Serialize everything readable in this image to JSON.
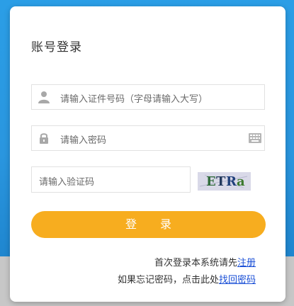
{
  "login": {
    "title": "账号登录",
    "id_placeholder": "请输入证件号码（字母请输入大写）",
    "password_placeholder": "请输入密码",
    "captcha_placeholder": "请输入验证码",
    "captcha_text": [
      "E",
      "T",
      "R",
      "a"
    ],
    "login_button": "登 录",
    "first_login_text": "首次登录本系统请先",
    "register_link": "注册",
    "forgot_text": "如果忘记密码，点击此处",
    "recover_link": "找回密码"
  },
  "colors": {
    "background": "#2a96df",
    "button": "#f7ad1f",
    "link": "#1a4fd6"
  },
  "icons": [
    "user-icon",
    "lock-icon",
    "keyboard-icon"
  ]
}
